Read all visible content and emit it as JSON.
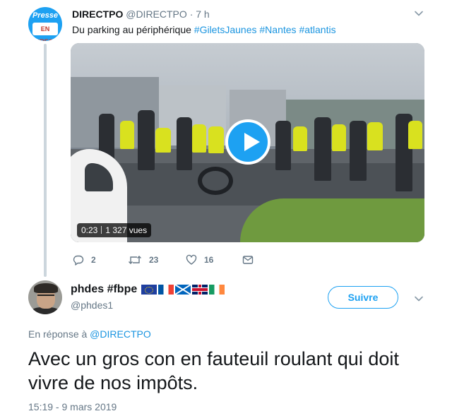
{
  "parent_tweet": {
    "avatar_text_top": "Presse",
    "avatar_text_bottom": "EN DIRECT",
    "name": "DIRECTPO",
    "handle": "@DIRECTPO",
    "dot": "·",
    "time": "7 h",
    "text": "Du parking au périphérique ",
    "hashtags": [
      "#GiletsJaunes",
      "#Nantes",
      "#atlantis"
    ],
    "video": {
      "duration": "0:23",
      "views": "1 327 vues"
    },
    "actions": {
      "reply_count": "2",
      "retweet_count": "23",
      "like_count": "16"
    },
    "colors": {
      "accent": "#1da1f2",
      "muted": "#657786"
    }
  },
  "reply_tweet": {
    "name": "phdes #fbpe",
    "flags": [
      "eu-flag",
      "france-flag",
      "scotland-flag",
      "uk-flag",
      "ireland-flag"
    ],
    "handle": "@phdes1",
    "follow_label": "Suivre",
    "in_reply_prefix": "En réponse à ",
    "in_reply_mention": "@DIRECTPO",
    "text": "Avec un gros con en fauteuil roulant qui doit vivre de nos impôts.",
    "timestamp": "15:19 - 9 mars 2019"
  }
}
